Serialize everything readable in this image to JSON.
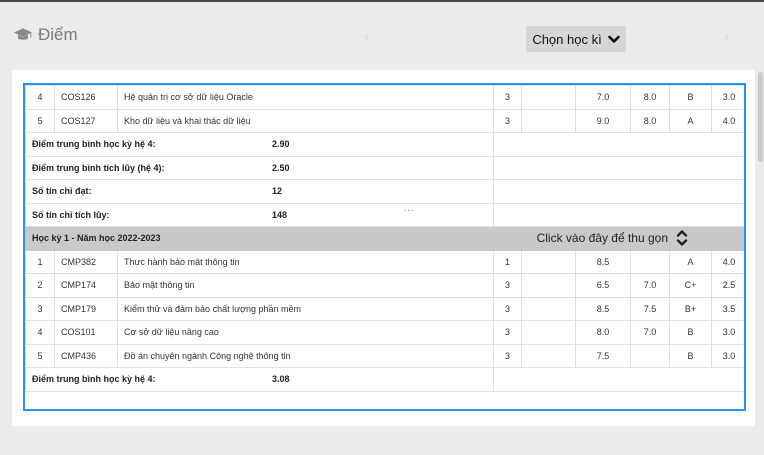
{
  "header": {
    "title": "Điểm",
    "semester_button": "Chọn học kì"
  },
  "table_prev": {
    "rows": [
      [
        "4",
        "COS126",
        "Hệ quản trị cơ sở dữ liệu Oracle",
        "3",
        "",
        "7.0",
        "8.0",
        "B",
        "3.0"
      ],
      [
        "5",
        "COS127",
        "Kho dữ liệu và khai thác dữ liệu",
        "3",
        "",
        "9.0",
        "8.0",
        "A",
        "4.0"
      ]
    ],
    "summary": [
      {
        "label": "Điểm trung bình học kỳ hệ 4:",
        "value": "2.90"
      },
      {
        "label": "Điểm trung bình tích lũy (hệ 4):",
        "value": "2.50"
      },
      {
        "label": "Số tín chỉ đạt:",
        "value": "12"
      },
      {
        "label": "Số tín chỉ tích lũy:",
        "value": "148"
      }
    ]
  },
  "semester": {
    "title": "Học kỳ 1 - Năm học 2022-2023",
    "collapse_label": "Click vào đây để thu gọn"
  },
  "table_cur": {
    "rows": [
      [
        "1",
        "CMP382",
        "Thực hành bảo mật thông tin",
        "1",
        "",
        "8.5",
        "",
        "A",
        "4.0"
      ],
      [
        "2",
        "CMP174",
        "Bảo mật thông tin",
        "3",
        "",
        "6.5",
        "7.0",
        "C+",
        "2.5"
      ],
      [
        "3",
        "CMP179",
        "Kiểm thử và đảm bảo chất lượng phần mềm",
        "3",
        "",
        "8.5",
        "7.5",
        "B+",
        "3.5"
      ],
      [
        "4",
        "COS101",
        "Cơ sở dữ liệu nâng cao",
        "3",
        "",
        "8.0",
        "7.0",
        "B",
        "3.0"
      ],
      [
        "5",
        "CMP436",
        "Đồ án chuyên ngành Công nghệ thông tin",
        "3",
        "",
        "7.5",
        "",
        "B",
        "3.0"
      ]
    ],
    "summary": [
      {
        "label": "Điểm trung bình học kỳ hệ 4:",
        "value": "3.08"
      }
    ]
  },
  "overlay": {
    "dots": "..."
  }
}
